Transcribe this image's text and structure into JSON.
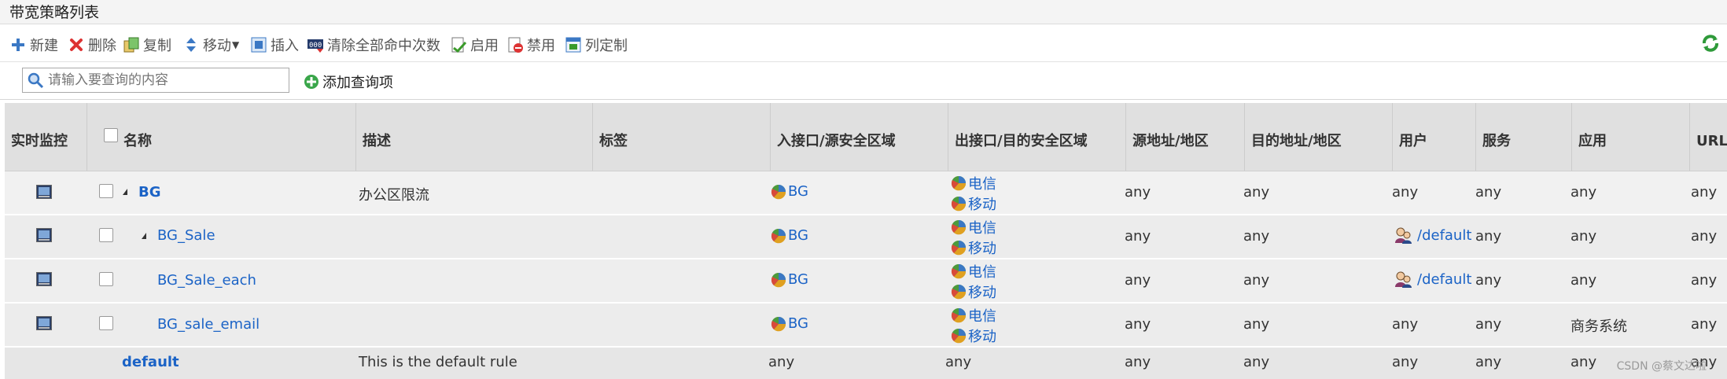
{
  "window": {
    "title": "带宽策略列表"
  },
  "toolbar": {
    "new": "新建",
    "delete": "删除",
    "copy": "复制",
    "move": "移动",
    "insert": "插入",
    "clear_hits": "清除全部命中次数",
    "enable": "启用",
    "disable": "禁用",
    "column_custom": "列定制"
  },
  "search": {
    "placeholder": "请输入要查询的内容",
    "add_query": "添加查询项"
  },
  "columns": [
    "实时监控",
    "名称",
    "描述",
    "标签",
    "入接口/源安全区域",
    "出接口/目的安全区域",
    "源地址/地区",
    "目的地址/地区",
    "用户",
    "服务",
    "应用",
    "URL分"
  ],
  "rows": [
    {
      "name": "BG",
      "description": "办公区限流",
      "label": "",
      "in_zone": "BG",
      "out_zones": [
        "电信",
        "移动"
      ],
      "src": "any",
      "dst": "any",
      "user": "any",
      "service": "any",
      "app": "any",
      "url": "any"
    },
    {
      "name": "BG_Sale",
      "description": "",
      "label": "",
      "in_zone": "BG",
      "out_zones": [
        "电信",
        "移动"
      ],
      "src": "any",
      "dst": "any",
      "user": "/default",
      "service": "any",
      "app": "any",
      "url": "any"
    },
    {
      "name": "BG_Sale_each",
      "description": "",
      "label": "",
      "in_zone": "BG",
      "out_zones": [
        "电信",
        "移动"
      ],
      "src": "any",
      "dst": "any",
      "user": "/default",
      "service": "any",
      "app": "any",
      "url": "any"
    },
    {
      "name": "BG_sale_email",
      "description": "",
      "label": "",
      "in_zone": "BG",
      "out_zones": [
        "电信",
        "移动"
      ],
      "src": "any",
      "dst": "any",
      "user": "any",
      "service": "any",
      "app": "商务系统",
      "url": "any"
    },
    {
      "name": "default",
      "description": "This is the default rule",
      "label": "",
      "in_zone": "any",
      "out_zone": "any",
      "src": "any",
      "dst": "any",
      "user": "any",
      "service": "any",
      "app": "any",
      "url": "any"
    }
  ],
  "watermark": "CSDN @蔡文达啦",
  "colors": {
    "link": "#1b63c6",
    "header_bg": "#e0e0e0",
    "row_bg": "#f0f0f0"
  },
  "icons": [
    "plus-icon",
    "delete-x-icon",
    "copy-icon",
    "move-arrows-icon",
    "insert-icon",
    "counter-icon",
    "enable-icon",
    "disable-icon",
    "column-custom-icon",
    "search-icon",
    "add-circle-icon",
    "monitor-icon",
    "zone-pie-icon",
    "user-icon",
    "refresh-icon"
  ]
}
